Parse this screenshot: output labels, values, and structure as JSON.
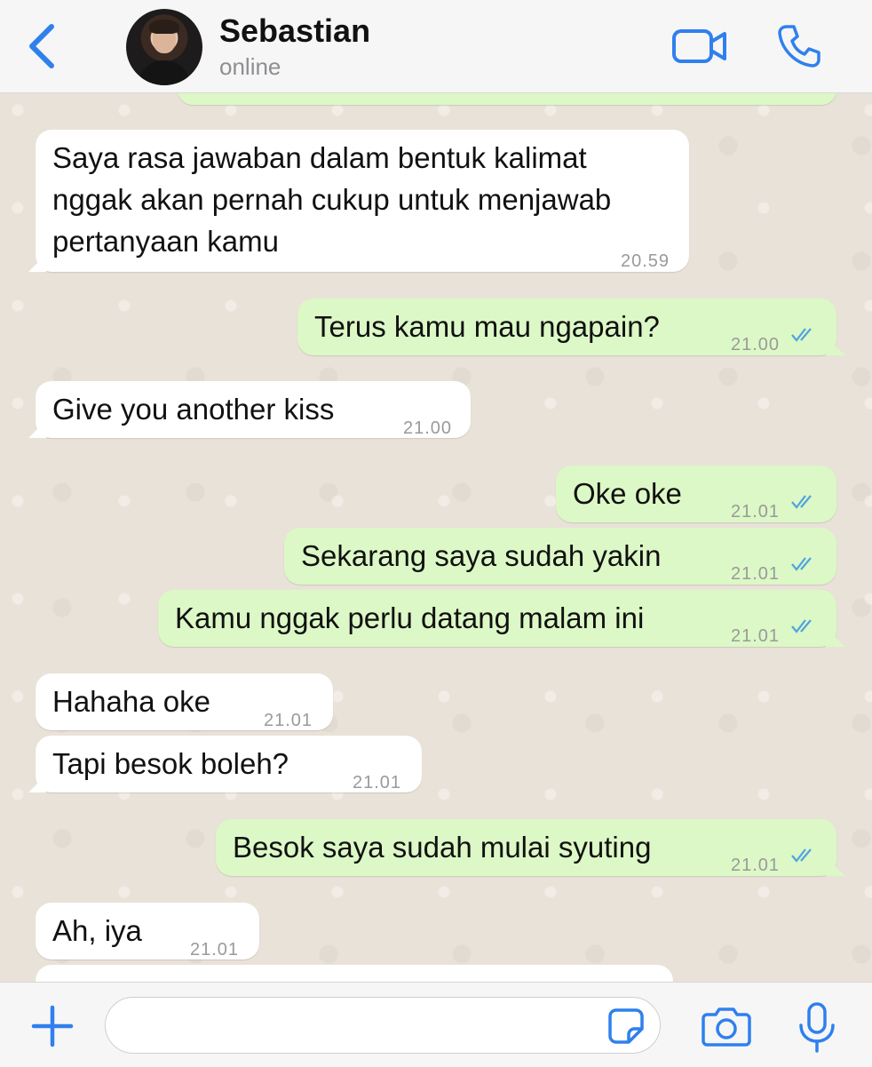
{
  "header": {
    "contact_name": "Sebastian",
    "status": "online"
  },
  "messages": [
    {
      "direction": "in",
      "text": "Saya rasa jawaban dalam bentuk kalimat nggak akan pernah cukup untuk menjawab pertanyaan kamu",
      "time": "20.59"
    },
    {
      "direction": "out",
      "text": "Terus kamu mau ngapain?",
      "time": "21.00",
      "read": true
    },
    {
      "direction": "in",
      "text": "Give you another kiss",
      "time": "21.00"
    },
    {
      "direction": "out",
      "text": "Oke oke",
      "time": "21.01",
      "read": true
    },
    {
      "direction": "out",
      "text": "Sekarang saya sudah yakin",
      "time": "21.01",
      "read": true
    },
    {
      "direction": "out",
      "text": "Kamu nggak perlu datang malam ini",
      "time": "21.01",
      "read": true
    },
    {
      "direction": "in",
      "text": "Hahaha oke",
      "time": "21.01"
    },
    {
      "direction": "in",
      "text": "Tapi besok boleh?",
      "time": "21.01"
    },
    {
      "direction": "out",
      "text": "Besok saya sudah mulai syuting",
      "time": "21.01",
      "read": true
    },
    {
      "direction": "in",
      "text": "Ah, iya",
      "time": "21.01"
    }
  ],
  "composer": {
    "value": "",
    "placeholder": ""
  },
  "icons": {
    "back": "chevron-left-icon",
    "video": "video-camera-icon",
    "call": "phone-icon",
    "attach": "plus-icon",
    "sticker": "sticker-icon",
    "camera": "camera-icon",
    "mic": "microphone-icon",
    "read_receipt": "double-check-icon"
  },
  "colors": {
    "accent": "#2f80ed",
    "incoming_bubble": "#ffffff",
    "outgoing_bubble": "#dcf8c6",
    "read_tick": "#4fa3e0"
  }
}
